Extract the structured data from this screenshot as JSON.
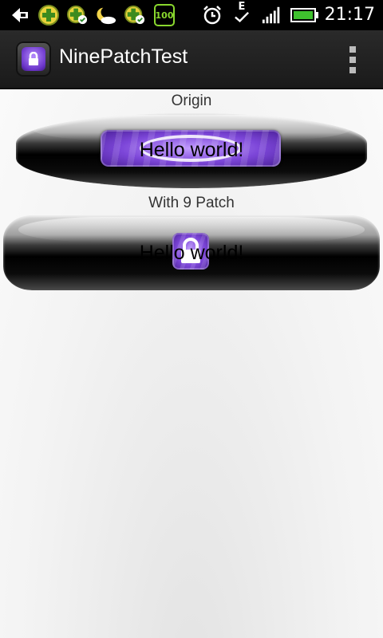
{
  "status_bar": {
    "time": "21:17",
    "battery_badge": "100",
    "network_type": "E",
    "icons": [
      "back-arrow-icon",
      "shield-plus-icon",
      "shield-check-icon",
      "weather-moon-icon",
      "shield-check-icon",
      "battery-saver-icon",
      "alarm-icon",
      "network-e-icon",
      "signal-icon",
      "battery-icon"
    ]
  },
  "action_bar": {
    "title": "NinePatchTest",
    "app_icon": "lock-icon",
    "menu_icon": "overflow-menu-icon"
  },
  "sections": [
    {
      "label": "Origin",
      "button_text": "Hello world!"
    },
    {
      "label": "With 9 Patch",
      "button_text": "Hello world!"
    }
  ],
  "colors": {
    "accent_purple": "#7c46d8",
    "statusbar_bg": "#000000",
    "actionbar_bg": "#222222"
  }
}
